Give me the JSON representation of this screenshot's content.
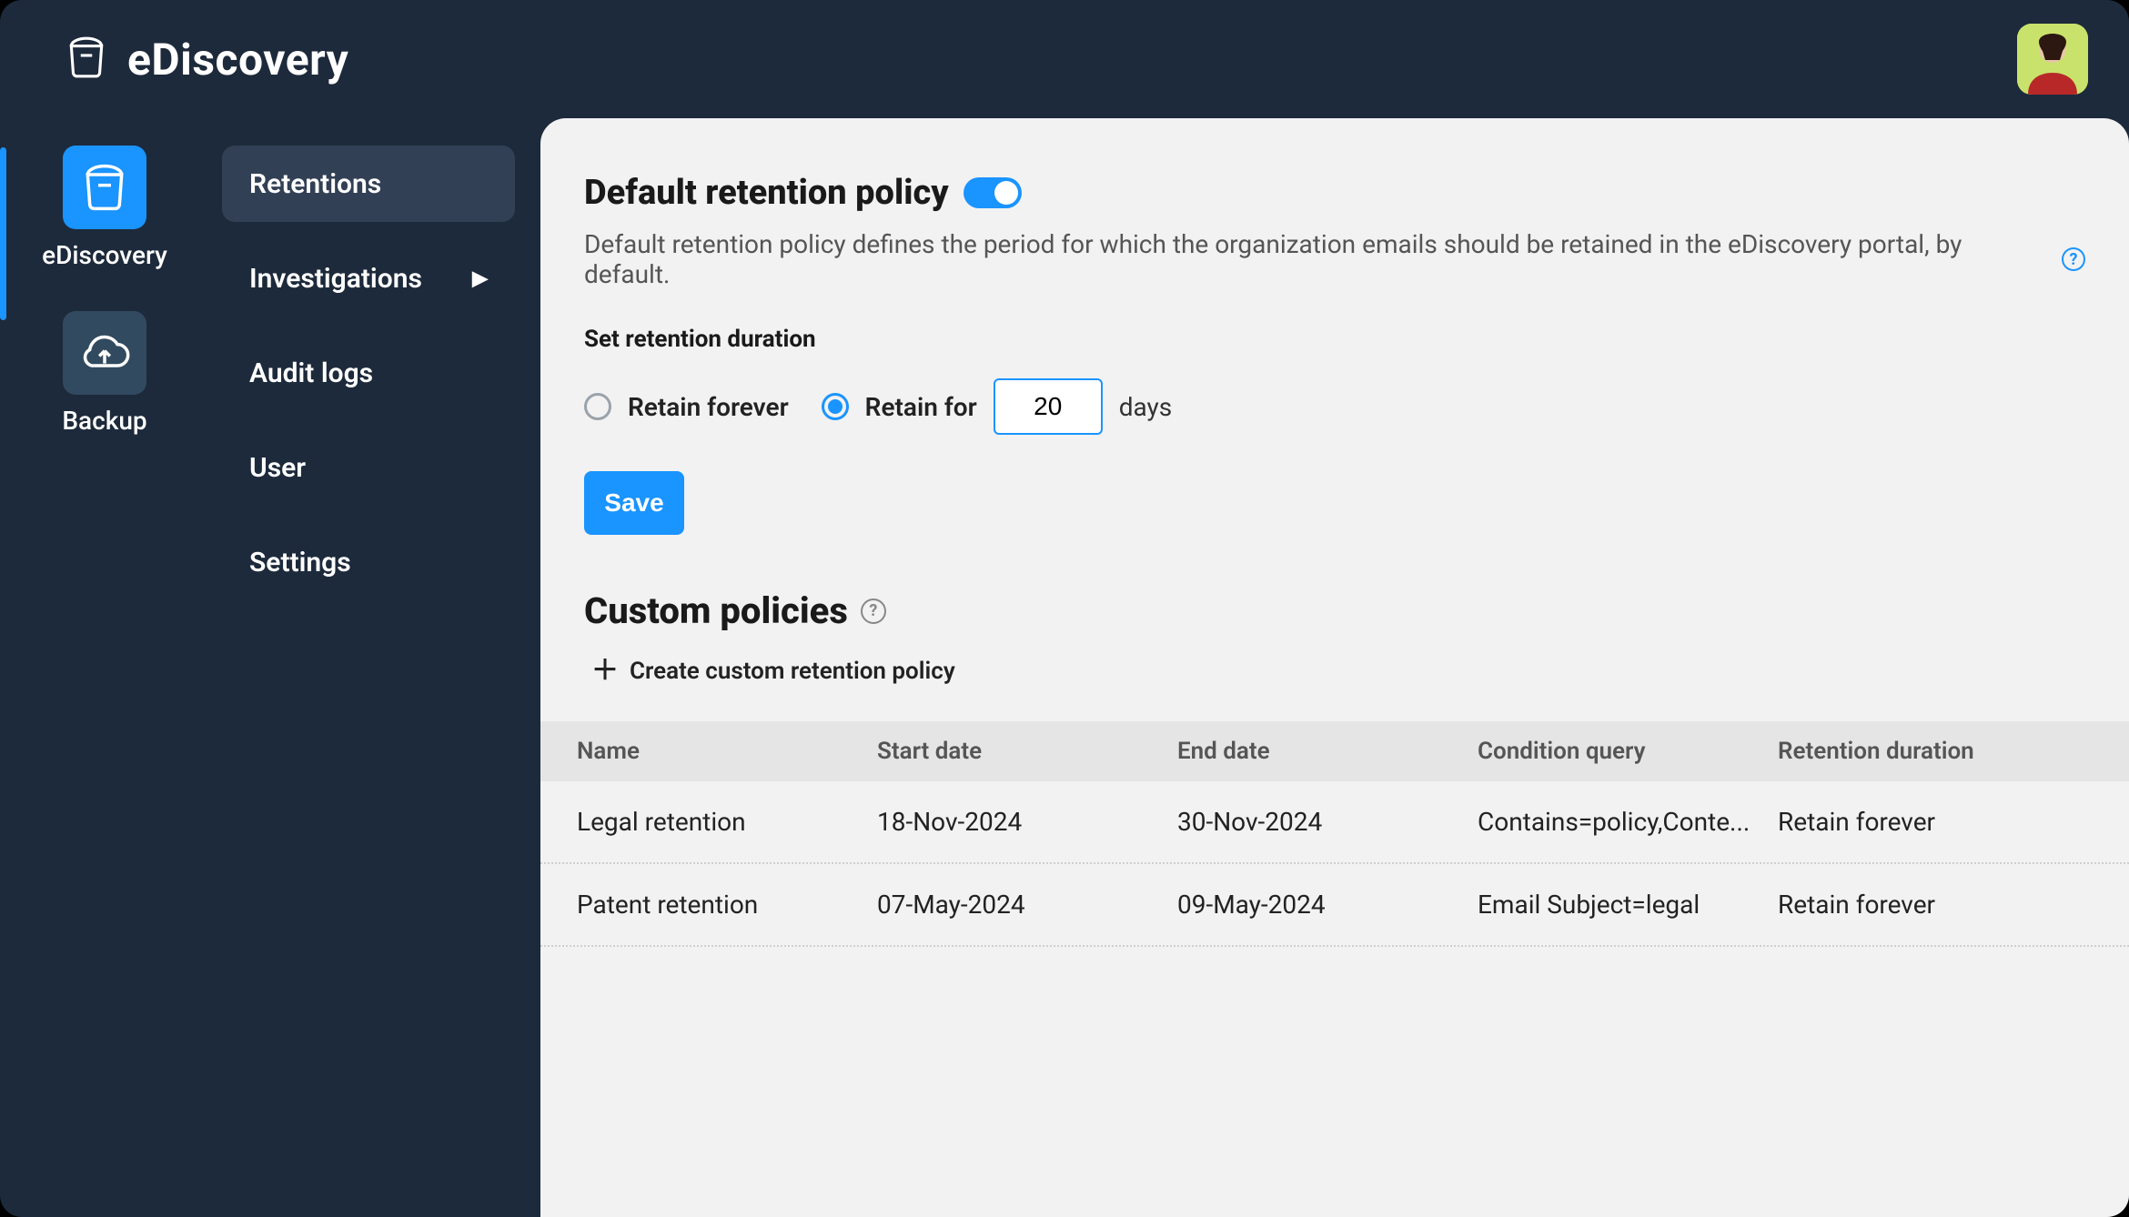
{
  "header": {
    "app_title": "eDiscovery"
  },
  "leftrail": {
    "items": [
      {
        "label": "eDiscovery",
        "icon": "archive-icon",
        "active": true
      },
      {
        "label": "Backup",
        "icon": "cloud-upload-icon",
        "active": false
      }
    ]
  },
  "sidebar": {
    "items": [
      {
        "label": "Retentions",
        "active": true,
        "has_submenu": false
      },
      {
        "label": "Investigations",
        "active": false,
        "has_submenu": true
      },
      {
        "label": "Audit logs",
        "active": false,
        "has_submenu": false
      },
      {
        "label": "User",
        "active": false,
        "has_submenu": false
      },
      {
        "label": "Settings",
        "active": false,
        "has_submenu": false
      }
    ]
  },
  "main": {
    "default_policy": {
      "title": "Default retention policy",
      "toggle_on": true,
      "description": "Default retention policy defines the period for which the organization emails should be retained in the eDiscovery portal, by default.",
      "duration_heading": "Set retention duration",
      "options": {
        "retain_forever_label": "Retain forever",
        "retain_for_label": "Retain for",
        "selected": "retain_for",
        "days_value": "20",
        "days_unit": "days"
      },
      "save_label": "Save"
    },
    "custom": {
      "title": "Custom policies",
      "create_label": "Create custom retention policy",
      "columns": {
        "name": "Name",
        "start": "Start date",
        "end": "End date",
        "condition": "Condition query",
        "retention": "Retention duration"
      },
      "rows": [
        {
          "name": "Legal retention",
          "start": "18-Nov-2024",
          "end": "30-Nov-2024",
          "condition": "Contains=policy,Conte...",
          "retention": "Retain forever"
        },
        {
          "name": "Patent retention",
          "start": "07-May-2024",
          "end": "09-May-2024",
          "condition": "Email Subject=legal",
          "retention": "Retain forever"
        }
      ]
    }
  }
}
